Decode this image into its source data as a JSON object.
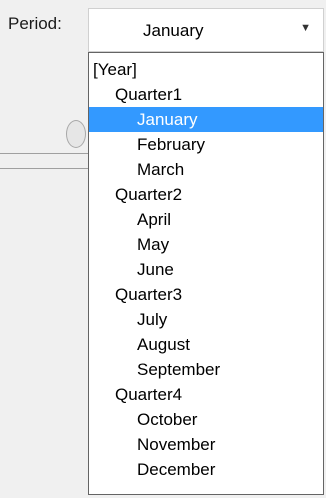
{
  "period": {
    "label": "Period:",
    "selected_value": "January",
    "arrow_icon": "chevron-down-icon"
  },
  "dropdown": {
    "items": [
      {
        "label": "[Year]",
        "level": 0,
        "selected": false
      },
      {
        "label": "Quarter1",
        "level": 1,
        "selected": false
      },
      {
        "label": "January",
        "level": 2,
        "selected": true
      },
      {
        "label": "February",
        "level": 2,
        "selected": false
      },
      {
        "label": "March",
        "level": 2,
        "selected": false
      },
      {
        "label": "Quarter2",
        "level": 1,
        "selected": false
      },
      {
        "label": "April",
        "level": 2,
        "selected": false
      },
      {
        "label": "May",
        "level": 2,
        "selected": false
      },
      {
        "label": "June",
        "level": 2,
        "selected": false
      },
      {
        "label": "Quarter3",
        "level": 1,
        "selected": false
      },
      {
        "label": "July",
        "level": 2,
        "selected": false
      },
      {
        "label": "August",
        "level": 2,
        "selected": false
      },
      {
        "label": "September",
        "level": 2,
        "selected": false
      },
      {
        "label": "Quarter4",
        "level": 1,
        "selected": false
      },
      {
        "label": "October",
        "level": 2,
        "selected": false
      },
      {
        "label": "November",
        "level": 2,
        "selected": false
      },
      {
        "label": "December",
        "level": 2,
        "selected": false
      }
    ]
  },
  "colors": {
    "selection_background": "#3399ff",
    "selection_text": "#ffffff"
  }
}
